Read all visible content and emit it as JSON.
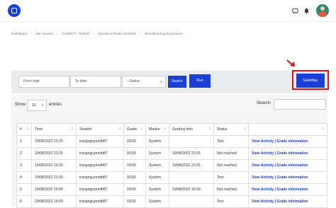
{
  "breadcrumb": [
    "Dashboard",
    "My courses",
    "CLIMBOT - RADIO",
    "Session 6 Radio Gamified",
    "Manufacturing Experience"
  ],
  "filters": {
    "from_placeholder": "From date",
    "to_placeholder": "To date",
    "status_value": "--Status--",
    "search_label": "Search",
    "run_label": "Run",
    "gateway_label": "GateWay"
  },
  "table_controls": {
    "show_label": "Show",
    "length_value": "10",
    "entries_label": "entries",
    "search_label": "Search:"
  },
  "table": {
    "headers": [
      "#",
      "Time",
      "Student",
      "Grade",
      "Marker",
      "Grading time",
      "Status",
      ""
    ],
    "rows": [
      {
        "n": "1",
        "time": "19/08/2022 23:25",
        "student": "trangnguyendtt87",
        "grade": "0/100",
        "marker": "System",
        "grading_time": "",
        "status": "Test",
        "actions": "View Activity | Grade information"
      },
      {
        "n": "2",
        "time": "19/08/2022 23:25",
        "student": "trangnguyendtt87",
        "grade": "0/100",
        "marker": "System",
        "grading_time": "19/08/2022 23:25",
        "status": "Not reached",
        "actions": "View Activity | Grade information"
      },
      {
        "n": "3",
        "time": "19/08/2022 23:25",
        "student": "trangnguyendtt87",
        "grade": "0/100",
        "marker": "System",
        "grading_time": "19/08/2022 23:25",
        "status": "Not reached",
        "actions": "View Activity | Grade information"
      },
      {
        "n": "4",
        "time": "19/08/2022 23:25",
        "student": "trangnguyendtt87",
        "grade": "0/100",
        "marker": "System",
        "grading_time": "",
        "status": "Test",
        "actions": "View Activity | Grade information"
      },
      {
        "n": "5",
        "time": "19/08/2022 16:00",
        "student": "trangnguyendtt87",
        "grade": "0/100",
        "marker": "System",
        "grading_time": "19/08/2022 16:00",
        "status": "Not reached",
        "actions": "View Activity | Grade information"
      },
      {
        "n": "6",
        "time": "19/08/2022 16:00",
        "student": "trangnguyendtt87",
        "grade": "0/100",
        "marker": "System",
        "grading_time": "",
        "status": "Test",
        "actions": "View Activity | Grade information"
      }
    ]
  },
  "colors": {
    "accent": "#1a3fd6",
    "highlight": "#e0101a"
  },
  "icons": [
    "app-logo-icon",
    "chat-icon",
    "bell-icon",
    "user-avatar"
  ]
}
